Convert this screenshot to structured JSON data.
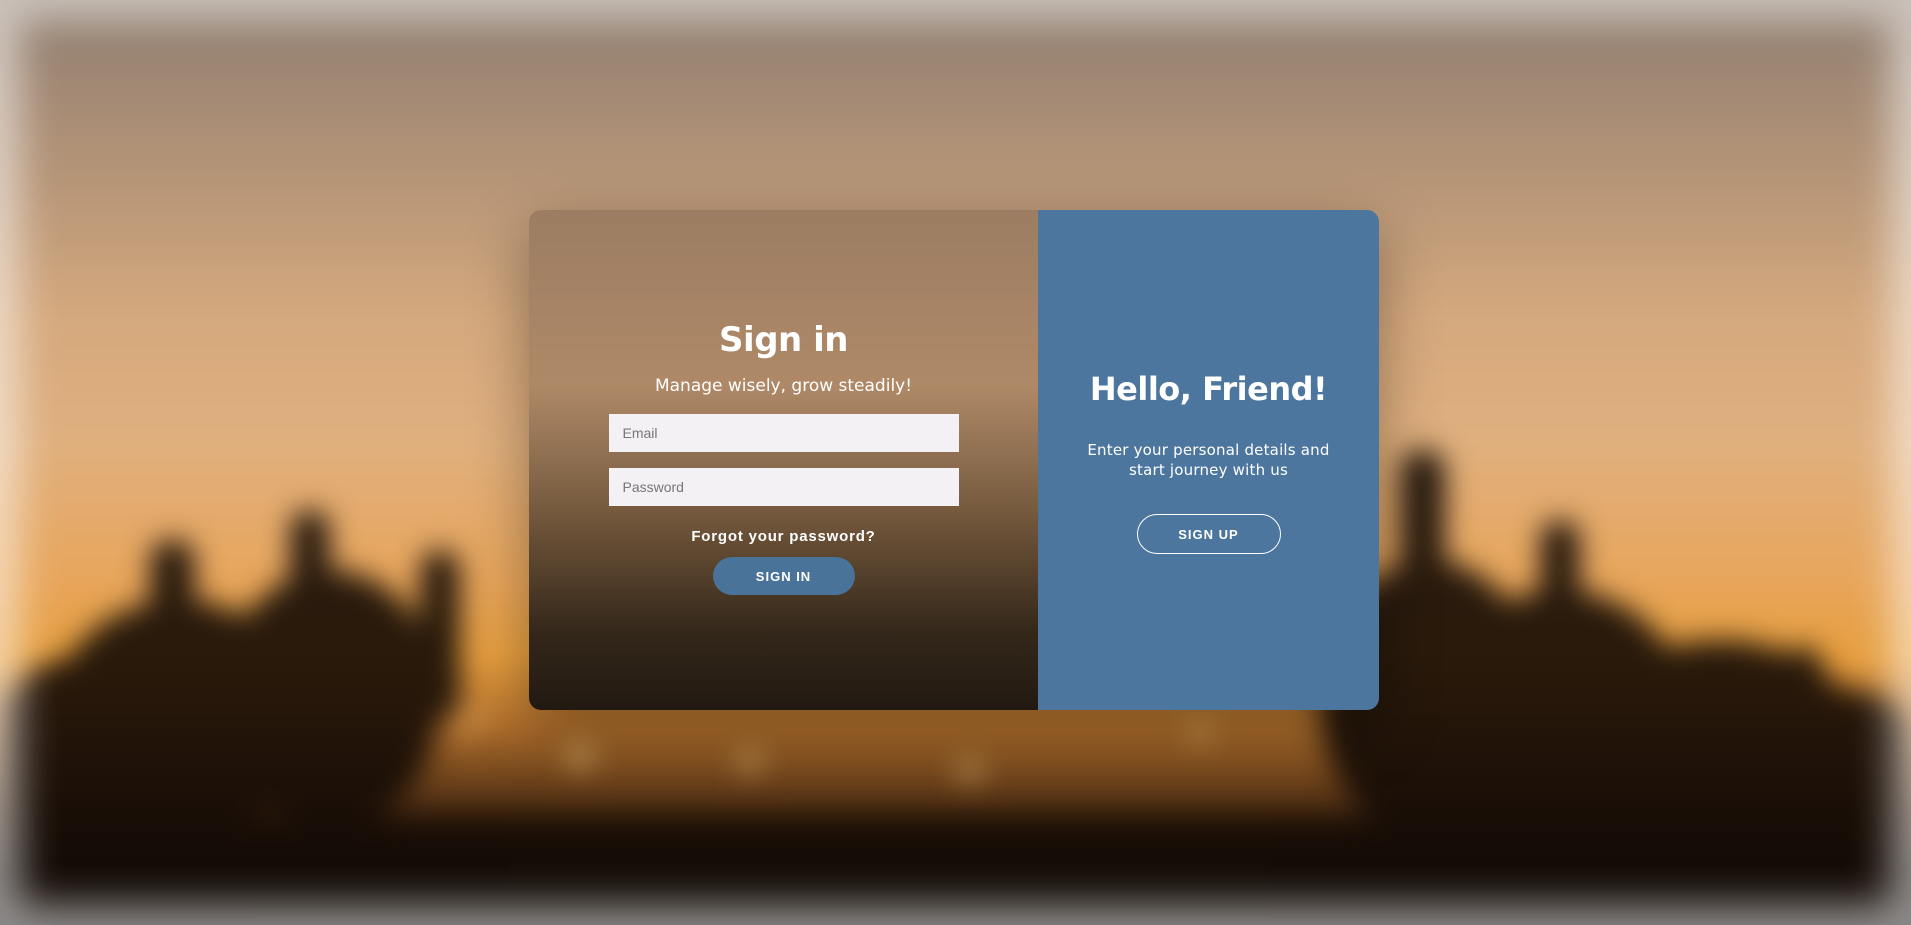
{
  "signin": {
    "title": "Sign in",
    "subtitle": "Manage wisely, grow steadily!",
    "email_placeholder": "Email",
    "password_placeholder": "Password",
    "forgot_label": "Forgot your password?",
    "button_label": "SIGN IN"
  },
  "overlay": {
    "title": "Hello, Friend!",
    "text": "Enter your personal details and start journey with us",
    "button_label": "SIGN UP"
  },
  "colors": {
    "accent": "#4c769d",
    "button": "#4a739a",
    "input_bg": "#f3f1f3"
  }
}
